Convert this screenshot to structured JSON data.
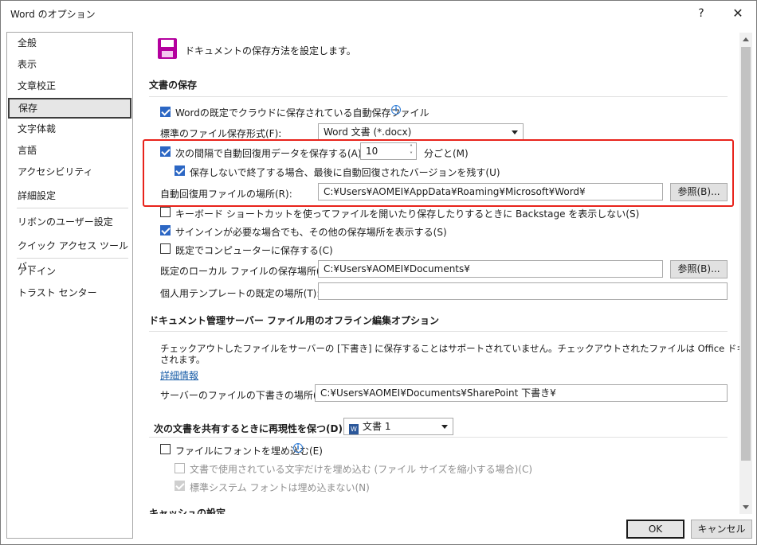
{
  "window": {
    "title": "Word のオプション",
    "help_label": "?",
    "close_label": "✕"
  },
  "sidebar": {
    "items": [
      {
        "label": "全般"
      },
      {
        "label": "表示"
      },
      {
        "label": "文章校正"
      },
      {
        "label": "保存",
        "selected": true
      },
      {
        "label": "文字体裁"
      },
      {
        "label": "言語"
      },
      {
        "label": "アクセシビリティ"
      },
      {
        "label": "詳細設定"
      },
      {
        "label": "リボンのユーザー設定"
      },
      {
        "label": "クイック アクセス ツール バー"
      },
      {
        "label": "アドイン"
      },
      {
        "label": "トラスト センター"
      }
    ]
  },
  "header": {
    "icon": "save-floppy-icon",
    "text": "ドキュメントの保存方法を設定します。"
  },
  "save_section": {
    "title": "文書の保存",
    "autosave_cloud": {
      "label": "Wordの既定でクラウドに保存されている自動保存ファイル",
      "checked": true
    },
    "default_format": {
      "label": "標準のファイル保存形式(F):",
      "value": "Word 文書 (*.docx)"
    },
    "autorecover": {
      "label": "次の間隔で自動回復用データを保存する(A):",
      "checked": true,
      "value": "10",
      "unit": "分ごと(M)"
    },
    "keep_last": {
      "label": "保存しないで終了する場合、最後に自動回復されたバージョンを残す(U)",
      "checked": true
    },
    "autorecover_location": {
      "label": "自動回復用ファイルの場所(R):",
      "value": "C:¥Users¥AOMEI¥AppData¥Roaming¥Microsoft¥Word¥",
      "browse": "参照(B)..."
    },
    "backstage": {
      "label": "キーボード ショートカットを使ってファイルを開いたり保存したりするときに Backstage を表示しない(S)",
      "checked": false
    },
    "signin": {
      "label": "サインインが必要な場合でも、その他の保存場所を表示する(S)",
      "checked": true
    },
    "save_to_computer": {
      "label": "既定でコンピューターに保存する(C)",
      "checked": false
    },
    "local_location": {
      "label": "既定のローカル ファイルの保存場所(I):",
      "value": "C:¥Users¥AOMEI¥Documents¥",
      "browse": "参照(B)..."
    },
    "template_location": {
      "label": "個人用テンプレートの既定の場所(T):",
      "value": ""
    }
  },
  "offline_section": {
    "title": "ドキュメント管理サーバー ファイル用のオフライン編集オプション",
    "description_line1": "チェックアウトしたファイルをサーバーの [下書き] に保存することはサポートされていません。チェックアウトされたファイルは Office ドキュメント キャッシュに保存",
    "description_line2": "されます。",
    "link": "詳細情報",
    "drafts_location": {
      "label": "サーバーのファイルの下書きの場所(V):",
      "value": "C:¥Users¥AOMEI¥Documents¥SharePoint 下書き¥"
    }
  },
  "fidelity_section": {
    "title": "次の文書を共有するときに再現性を保つ(D):",
    "document": "文書 1",
    "embed_fonts": {
      "label": "ファイルにフォントを埋め込む(E)",
      "checked": false
    },
    "embed_used_chars": {
      "label": "文書で使用されている文字だけを埋め込む (ファイル サイズを縮小する場合)(C)",
      "checked": false
    },
    "no_system_fonts": {
      "label": "標準システム フォントは埋め込まない(N)",
      "checked": true
    }
  },
  "cache_section": {
    "title": "キャッシュの設定"
  },
  "footer": {
    "ok": "OK",
    "cancel": "キャンセル"
  },
  "colors": {
    "highlight": "#e8231b",
    "checkbox": "#2c67c4",
    "link": "#1a5ea8"
  }
}
